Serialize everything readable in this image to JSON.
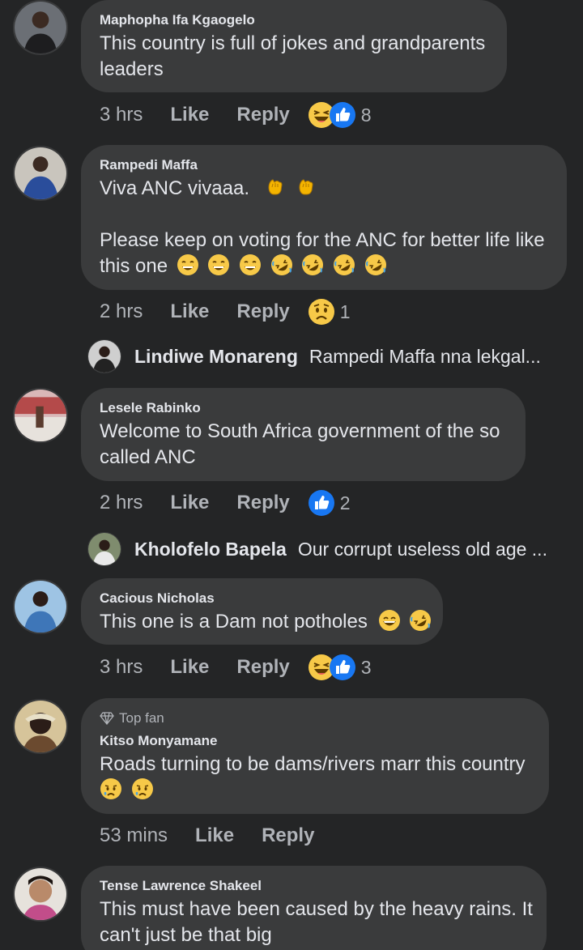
{
  "comments": [
    {
      "author": "Maphopha Ifa Kgaogelo",
      "lines": [
        "This country is full of jokes and grandparents",
        "leaders"
      ],
      "time": "3 hrs",
      "like": "Like",
      "reply": "Reply",
      "reactions": [
        "haha-icon",
        "like-icon"
      ],
      "count": "8"
    },
    {
      "author": "Rampedi Maffa",
      "line1": "Viva ANC vivaaa.",
      "line2": "Please keep on voting for the ANC for better life like",
      "line3": "this one",
      "time": "2 hrs",
      "like": "Like",
      "reply": "Reply",
      "reactions": [
        "sad-icon"
      ],
      "count": "1",
      "reply_preview": {
        "name": "Lindiwe Monareng",
        "text": "Rampedi Maffa  nna lekgal..."
      }
    },
    {
      "author": "Lesele Rabinko",
      "lines": [
        "Welcome to South Africa government of the so",
        "called ANC"
      ],
      "time": "2 hrs",
      "like": "Like",
      "reply": "Reply",
      "reactions": [
        "like-icon"
      ],
      "count": "2",
      "reply_preview": {
        "name": "Kholofelo Bapela",
        "text": "Our corrupt useless old age ..."
      }
    },
    {
      "author": "Cacious Nicholas",
      "line1": "This one is a Dam not potholes",
      "time": "3 hrs",
      "like": "Like",
      "reply": "Reply",
      "reactions": [
        "haha-icon",
        "like-icon"
      ],
      "count": "3"
    },
    {
      "badge": "Top fan",
      "author": "Kitso Monyamane",
      "line1": "Roads turning to be dams/rivers marr this country",
      "time": "53 mins",
      "like": "Like",
      "reply": "Reply"
    },
    {
      "author": "Tense Lawrence Shakeel",
      "lines": [
        "This must have been caused by the heavy rains. It",
        "can't just be that big"
      ]
    }
  ],
  "colors": {
    "background": "#242526",
    "bubble": "#3a3b3c",
    "text": "#e4e6eb",
    "secondary": "#b0b3b8",
    "like_blue": "#1877f2",
    "emoji_yellow": "#f7c948"
  }
}
